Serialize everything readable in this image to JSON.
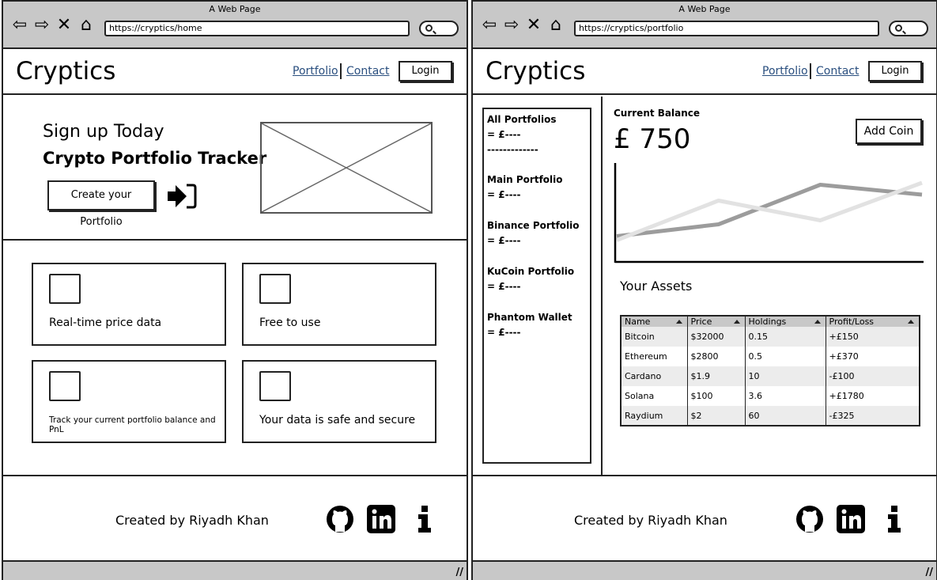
{
  "left": {
    "window_title": "A Web Page",
    "url": "https://cryptics/home",
    "brand": "Cryptics",
    "nav": {
      "portfolio": "Portfolio",
      "contact": "Contact",
      "login": "Login"
    },
    "hero": {
      "line1": "Sign up Today",
      "line2": "Crypto Portfolio Tracker",
      "cta": "Create your Portfolio"
    },
    "features": [
      {
        "text": "Real-time price data"
      },
      {
        "text": "Free to use"
      },
      {
        "text": "Track your current portfolio balance and PnL"
      },
      {
        "text": "Your data is safe and secure"
      }
    ],
    "footer": {
      "credit": "Created by Riyadh Khan"
    }
  },
  "right": {
    "window_title": "A Web Page",
    "url": "https://cryptics/portfolio",
    "brand": "Cryptics",
    "nav": {
      "portfolio": "Portfolio",
      "contact": "Contact",
      "login": "Login"
    },
    "portfolios": [
      {
        "name": "All Portfolios",
        "value": "= £----",
        "divider": "-------------"
      },
      {
        "name": "Main Portfolio",
        "value": "= £----"
      },
      {
        "name": "Binance Portfolio",
        "value": "= £----"
      },
      {
        "name": "KuCoin Portfolio",
        "value": "= £----"
      },
      {
        "name": "Phantom Wallet",
        "value": "= £----"
      }
    ],
    "balance": {
      "label": "Current Balance",
      "value": "£ 750"
    },
    "add_coin": "Add Coin",
    "assets_title": "Your Assets",
    "table": {
      "headers": [
        "Name",
        "Price",
        "Holdings",
        "Profit/Loss"
      ],
      "rows": [
        [
          "Bitcoin",
          "$32000",
          "0.15",
          "+£150"
        ],
        [
          "Ethereum",
          "$2800",
          "0.5",
          "+£370"
        ],
        [
          "Cardano",
          "$1.9",
          "10",
          "-£100"
        ],
        [
          "Solana",
          "$100",
          "3.6",
          "+£1780"
        ],
        [
          "Raydium",
          "$2",
          "60",
          "-£325"
        ]
      ]
    },
    "footer": {
      "credit": "Created by Riyadh Khan"
    }
  },
  "chart_data": {
    "type": "line",
    "title": "",
    "xlabel": "",
    "ylabel": "",
    "x": [
      0,
      1,
      2,
      3
    ],
    "series": [
      {
        "values": [
          22,
          62,
          42,
          80
        ],
        "color": "#e2e2e2"
      },
      {
        "values": [
          26,
          38,
          78,
          68
        ],
        "color": "#9c9c9c"
      }
    ],
    "ylim": [
      0,
      100
    ],
    "grid": false
  },
  "icons": {
    "back": "back-arrow-icon",
    "forward": "forward-arrow-icon",
    "stop": "close-icon",
    "home": "home-icon",
    "search": "search-icon",
    "cta": "sign-in-arrow-icon",
    "github": "github-icon",
    "linkedin": "linkedin-icon",
    "info": "info-icon"
  },
  "colors": {
    "link": "#2a4f7f",
    "chrome": "#c8c8c8",
    "table_header": "#c8c8c8"
  }
}
